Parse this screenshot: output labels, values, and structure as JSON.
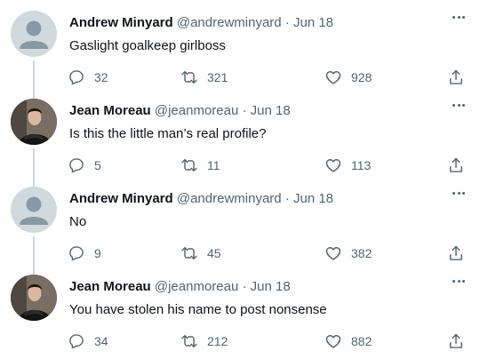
{
  "thread": {
    "tweets": [
      {
        "display_name": "Andrew Minyard",
        "handle": "@andrewminyard",
        "separator": "·",
        "date": "Jun 18",
        "text": "Gaslight goalkeep girlboss",
        "avatar": "default-profile-avatar",
        "replies": "32",
        "retweets": "321",
        "likes": "928"
      },
      {
        "display_name": "Jean Moreau",
        "handle": "@jeanmoreau",
        "separator": "·",
        "date": "Jun 18",
        "text": "Is this the little man’s real profile?",
        "avatar": "photo-avatar",
        "replies": "5",
        "retweets": "11",
        "likes": "113"
      },
      {
        "display_name": "Andrew Minyard",
        "handle": "@andrewminyard",
        "separator": "·",
        "date": "Jun 18",
        "text": "No",
        "avatar": "default-profile-avatar",
        "replies": "9",
        "retweets": "45",
        "likes": "382"
      },
      {
        "display_name": "Jean Moreau",
        "handle": "@jeanmoreau",
        "separator": "·",
        "date": "Jun 18",
        "text": "You have stolen his name to post nonsense",
        "avatar": "photo-avatar",
        "replies": "34",
        "retweets": "212",
        "likes": "882"
      }
    ]
  },
  "icons": {
    "reply": "reply-icon",
    "retweet": "retweet-icon",
    "like": "heart-icon",
    "share": "share-icon",
    "more": "more-icon"
  },
  "colors": {
    "text": "#0f1419",
    "secondary": "#536471",
    "thread_line": "#cfd9de",
    "default_avatar_bg": "#cfd9de"
  }
}
